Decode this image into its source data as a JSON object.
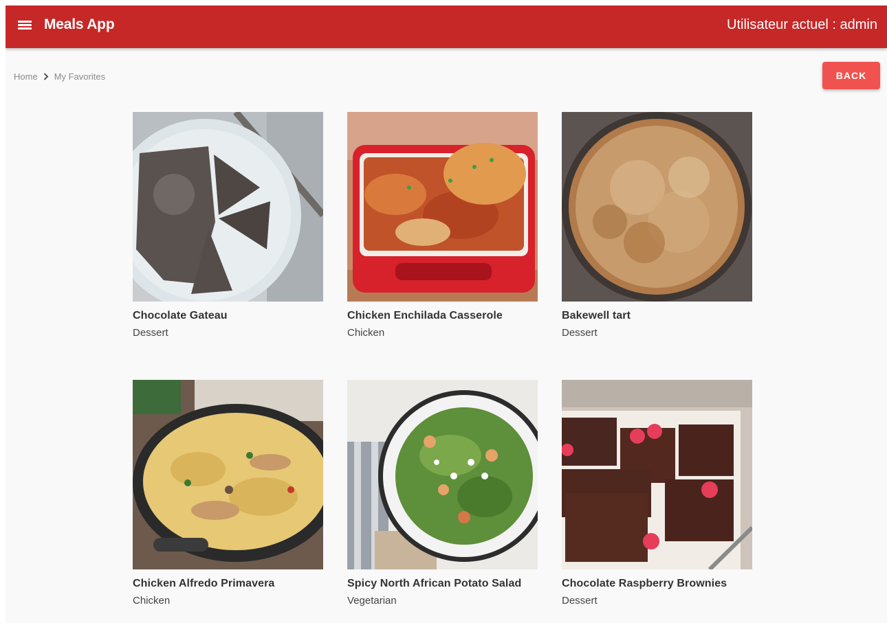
{
  "header": {
    "menu_icon": "hamburger-menu-icon",
    "title": "Meals App",
    "user_label": "Utilisateur actuel : admin",
    "color": "#c62828"
  },
  "breadcrumb": {
    "home": "Home",
    "separator_icon": "chevron-right-icon",
    "current": "My Favorites"
  },
  "back_button": {
    "label": "BACK",
    "color": "#f0534f"
  },
  "meals": [
    {
      "name": "Chocolate Gateau",
      "category": "Dessert"
    },
    {
      "name": "Chicken Enchilada Casserole",
      "category": "Chicken"
    },
    {
      "name": "Bakewell tart",
      "category": "Dessert"
    },
    {
      "name": "Chicken Alfredo Primavera",
      "category": "Chicken"
    },
    {
      "name": "Spicy North African Potato Salad",
      "category": "Vegetarian"
    },
    {
      "name": "Chocolate Raspberry Brownies",
      "category": "Dessert"
    }
  ]
}
